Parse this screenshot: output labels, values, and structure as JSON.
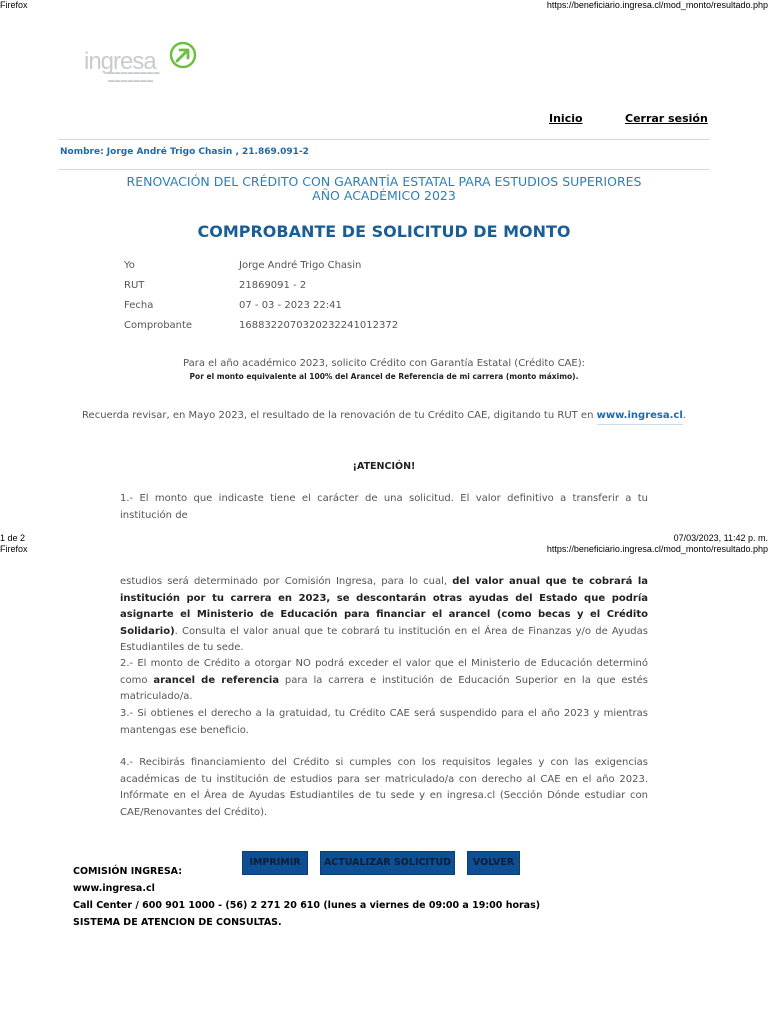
{
  "page1_header": {
    "browser": "Firefox",
    "url": "https://beneficiario.ingresa.cl/mod_monto/resultado.php"
  },
  "page1_footer": {
    "page_info": "1 de 2",
    "datetime": "07/03/2023, 11:42 p. m."
  },
  "page2_header": {
    "browser": "Firefox",
    "url": "https://beneficiario.ingresa.cl/mod_monto/resultado.php"
  },
  "logo": {
    "text": "ingresa",
    "brand_color": "#6cbf3f"
  },
  "nav": {
    "inicio": "Inicio",
    "cerrar": "Cerrar sesión"
  },
  "user": {
    "nombre": "Nombre: Jorge André Trigo Chasin , 21.869.091-2"
  },
  "header": {
    "line1": "RENOVACIÓN DEL CRÉDITO CON GARANTÍA ESTATAL PARA ESTUDIOS SUPERIORES",
    "line2": "AÑO ACADÉMICO 2023",
    "title": "COMPROBANTE DE SOLICITUD DE MONTO"
  },
  "info": [
    {
      "label": "Yo",
      "value": "Jorge André Trigo Chasin"
    },
    {
      "label": "RUT",
      "value": "21869091 - 2"
    },
    {
      "label": "Fecha",
      "value": "07 - 03 - 2023 22:41"
    },
    {
      "label": "Comprobante",
      "value": "1688322070320232241012372"
    }
  ],
  "solicitud": {
    "line1": "Para el año académico 2023, solicito Crédito con Garantía Estatal (Crédito CAE):",
    "line2": "Por el monto equivalente al 100% del Arancel de Referencia de mi carrera (monto máximo)."
  },
  "recuerda": {
    "text": "Recuerda revisar, en Mayo 2023, el resultado de la renovación de tu Crédito CAE, digitando tu RUT en",
    "link": "www.ingresa.cl",
    "end": "."
  },
  "atencion": "¡ATENCIÓN!",
  "para1_first": "1.- El monto que indicaste tiene el carácter de una solicitud. El valor definitivo a transferir a tu institución de",
  "para1": {
    "a": "estudios será determinado por Comisión Ingresa, para lo cual, ",
    "b": "del valor anual que te cobrará la institución por tu carrera en 2023, se descontarán otras ayudas del Estado que podría asignarte el Ministerio de Educación para financiar el arancel (como becas y el Crédito Solidario)",
    "c": ". Consulta el valor anual que te cobrará tu institución en el Área de Finanzas y/o de Ayudas Estudiantiles de tu sede."
  },
  "para2": {
    "a": "2.- El monto de Crédito a otorgar NO podrá exceder el valor que el Ministerio de Educación determinó como ",
    "b": "arancel de referencia",
    "c": " para la carrera e institución de Educación Superior en la que estés matriculado/a."
  },
  "para3": "3.- Si obtienes el derecho a la gratuidad, tu Crédito CAE será suspendido para el año 2023 y mientras mantengas ese beneficio.",
  "para4": "4.- Recibirás financiamiento del Crédito si cumples con los requisitos legales y con las exigencias académicas de tu institución de estudios para ser matriculado/a con derecho al CAE en el año 2023. Infórmate en el Área de Ayudas Estudiantiles de tu sede y en ingresa.cl (Sección Dónde estudiar con CAE/Renovantes del Crédito).",
  "buttons": {
    "imprimir": "IMPRIMIR",
    "actualizar": "ACTUALIZAR SOLICITUD",
    "volver": "VOLVER"
  },
  "footer": {
    "org": "COMISIÓN INGRESA:",
    "web": "www.ingresa.cl",
    "call": "Call Center / 600 901 1000 - (56) 2 271 20 610 (lunes a viernes de 09:00 a 19:00 horas)",
    "sistema": "SISTEMA DE ATENCION DE CONSULTAS."
  }
}
